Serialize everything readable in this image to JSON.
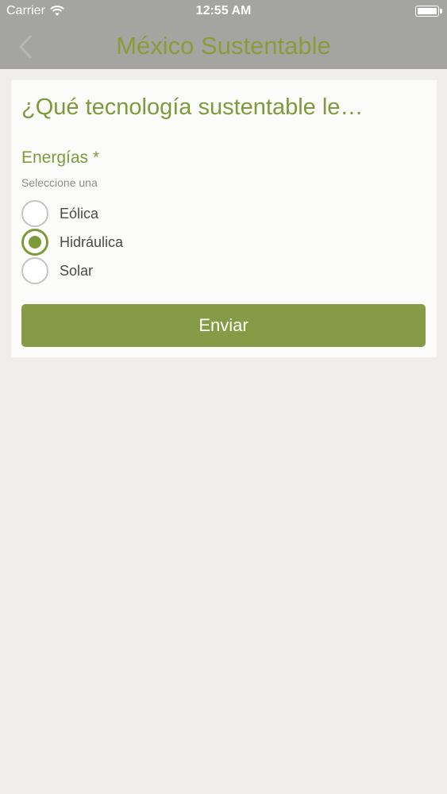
{
  "status_bar": {
    "carrier": "Carrier",
    "time": "12:55 AM",
    "wifi_icon": "wifi-icon",
    "battery_icon": "battery-icon"
  },
  "nav": {
    "back_icon": "chevron-left-icon",
    "title": "México Sustentable"
  },
  "form": {
    "question": "¿Qué tecnología sustentable le…",
    "field_label": "Energías *",
    "field_hint": "Seleccione una",
    "options": [
      {
        "label": "Eólica",
        "selected": false
      },
      {
        "label": "Hidráulica",
        "selected": true
      },
      {
        "label": "Solar",
        "selected": false
      }
    ],
    "submit_label": "Enviar"
  },
  "colors": {
    "accent": "#7c9a38",
    "button": "#869b45",
    "nav_background": "#a4a4a1",
    "page_background": "#efeeec"
  }
}
